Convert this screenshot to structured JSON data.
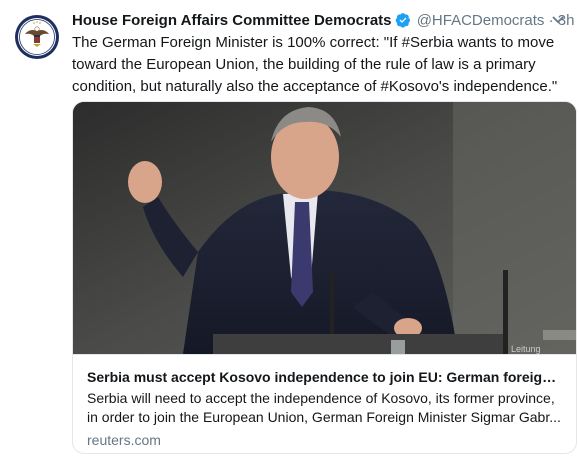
{
  "tweet": {
    "author_name": "House Foreign Affairs Committee Democrats",
    "handle": "@HFACDemocrats",
    "separator": "·",
    "time": "3h",
    "text": "The German Foreign Minister is 100% correct: \"If #Serbia wants to move toward the European Union, the building of the rule of law is a primary condition, but naturally also the acceptance of #Kosovo's independence.\""
  },
  "card": {
    "title": "Serbia must accept Kosovo independence to join EU: German foreign...",
    "description_line1": "Serbia will need to accept the independence of Kosovo, its former province,",
    "description_line2": "in order to join the European Union, German Foreign Minister Sigmar Gabr...",
    "domain": "reuters.com",
    "image_text": "Leitung"
  },
  "colors": {
    "verified": "#1da1f2",
    "secondary_text": "#657786",
    "border": "#e1e8ed"
  },
  "icons": [
    "verified-badge-icon",
    "caret-down-icon"
  ]
}
